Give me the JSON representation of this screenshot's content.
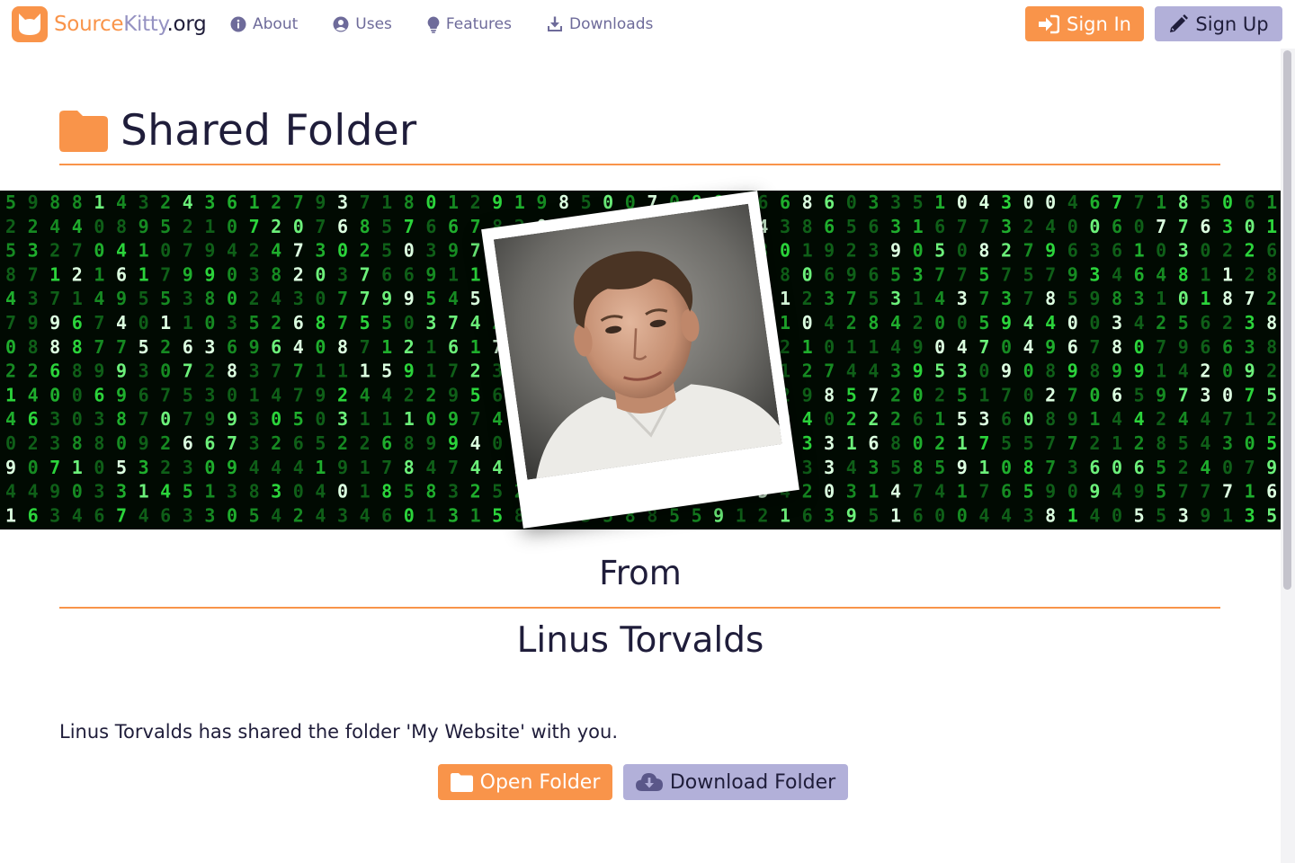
{
  "brand": {
    "source": "Source",
    "kitty": "Kitty",
    "org": ".org",
    "logo_icon": "cat-face-icon"
  },
  "nav": {
    "items": [
      {
        "label": "About",
        "icon": "info-circle-icon"
      },
      {
        "label": "Uses",
        "icon": "user-circle-icon"
      },
      {
        "label": "Features",
        "icon": "lightbulb-icon"
      },
      {
        "label": "Downloads",
        "icon": "download-icon"
      }
    ],
    "sign_in": "Sign In",
    "sign_up": "Sign Up"
  },
  "page": {
    "title": "Shared Folder",
    "title_icon": "folder-icon",
    "from_label": "From",
    "owner_name": "Linus Torvalds",
    "message": "Linus Torvalds has shared the folder 'My Website' with you.",
    "open_button": "Open Folder",
    "download_button": "Download Folder"
  },
  "banner": {
    "style": "green matrix digits",
    "photo": "portrait in polaroid frame"
  },
  "colors": {
    "accent": "#f9944a",
    "secondary": "#b2b0d9",
    "nav_text": "#6e6b9a",
    "text": "#1f1d3a",
    "matrix_green": "#2bd43b"
  }
}
